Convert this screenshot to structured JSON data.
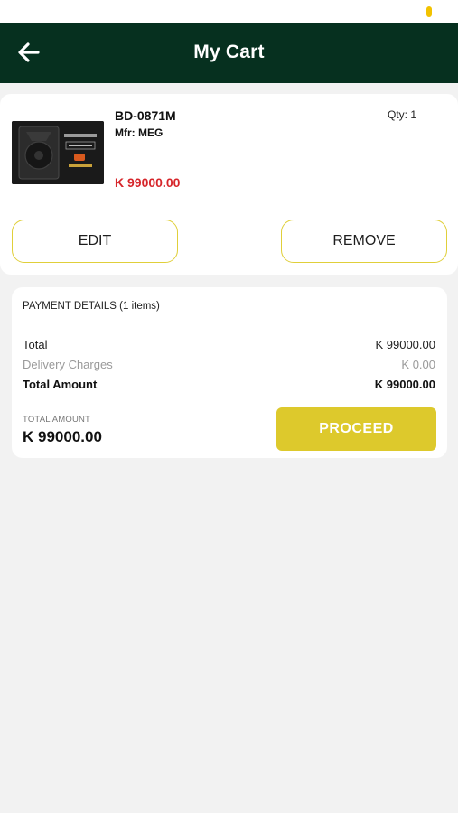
{
  "header": {
    "title": "My Cart",
    "back_icon": "arrow-left-icon",
    "background_color": "#06301f"
  },
  "cart": {
    "items": [
      {
        "sku": "BD-0871M",
        "manufacturer": "Mfr: MEG",
        "quantity": "Qty: 1",
        "price": "K 99000.00",
        "edit_label": "EDIT",
        "remove_label": "REMOVE"
      }
    ]
  },
  "payment": {
    "title": "PAYMENT DETAILS (1 items)",
    "rows": [
      {
        "label": "Total",
        "value": "K 99000.00"
      },
      {
        "label": "Delivery Charges",
        "value": "K 0.00"
      },
      {
        "label": "Total Amount",
        "value": "K 99000.00"
      }
    ],
    "footer_label": "TOTAL AMOUNT",
    "footer_amount": "K 99000.00",
    "proceed_label": "PROCEED"
  },
  "colors": {
    "accent": "#ddc92c",
    "price": "#d6252a",
    "muted": "#9a9a9a"
  }
}
